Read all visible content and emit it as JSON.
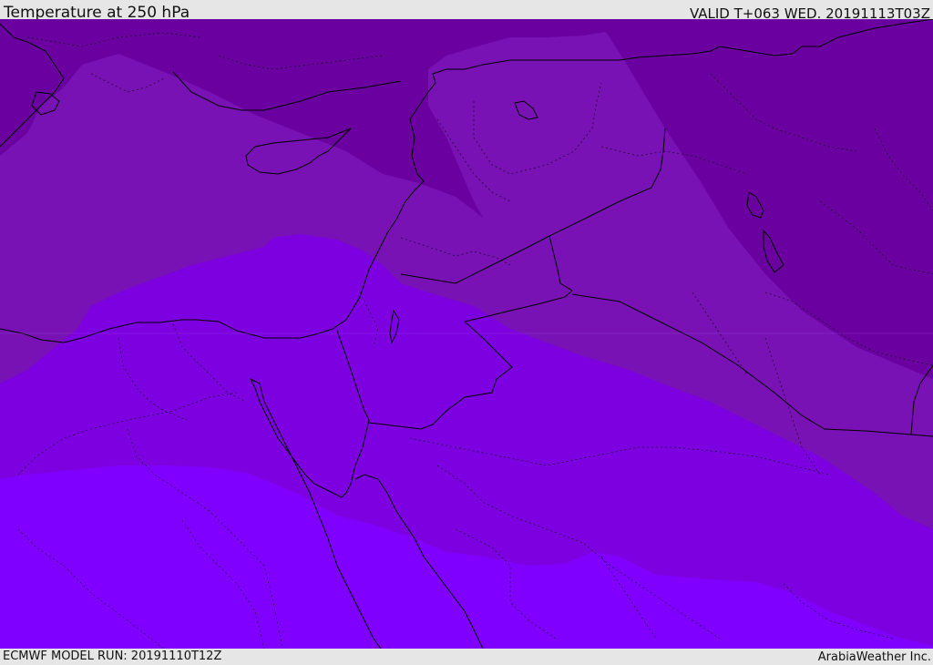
{
  "header": {
    "title": "Temperature at 250 hPa",
    "valid_time": "VALID T+063 WED. 20191113T03Z"
  },
  "footer": {
    "model_run": "ECMWF MODEL RUN: 20191110T12Z",
    "credit": "ArabiaWeather Inc."
  },
  "map": {
    "field": "Temperature at 250 hPa",
    "colors": {
      "band_1": "#6a00a0",
      "band_2": "#7812b4",
      "band_3": "#7c00e0",
      "band_4": "#8000ff",
      "border_line": "#000000"
    }
  }
}
